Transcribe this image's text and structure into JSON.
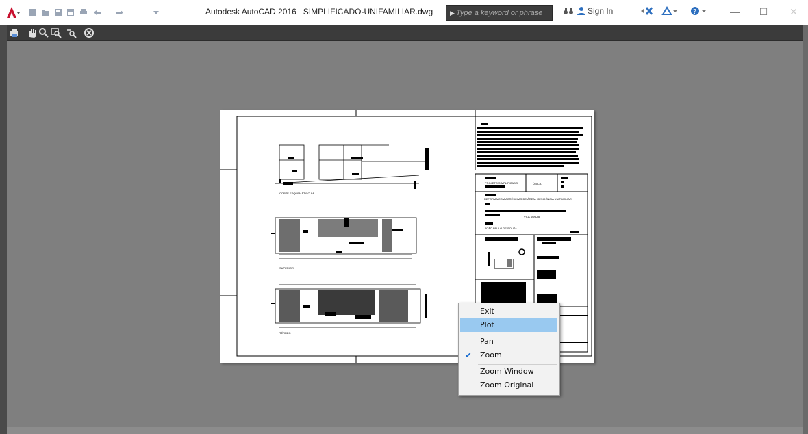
{
  "window": {
    "app_name": "Autodesk AutoCAD 2016",
    "file_name": "SIMPLIFICADO-UNIFAMILIAR.dwg",
    "controls": [
      "minimize-icon",
      "maximize-icon",
      "close-icon"
    ]
  },
  "search": {
    "placeholder": "Type a keyword or phrase"
  },
  "account": {
    "sign_in_label": "Sign In"
  },
  "quick_access_icons": [
    "new-icon",
    "open-icon",
    "save-icon",
    "save-as-icon",
    "plot-icon",
    "undo-icon",
    "redo-icon",
    "customize-icon"
  ],
  "preview_toolbar": {
    "tools": [
      "print-icon",
      "pan-icon",
      "zoom-icon",
      "zoom-window-icon",
      "zoom-original-icon",
      "close-preview-icon"
    ]
  },
  "sheet": {
    "views": [
      "CORTE ESQUEMÁTICO AA",
      "SUPERIOR",
      "TÉRREO"
    ],
    "title_block": {
      "project_label": "PROJETO SIMPLIFICADO",
      "unit_label": "ÚNICA",
      "description": "REFORMA COM ACRÉSCIMO DE ÁREA - RESIDÊNCIA UNIFAMILIAR",
      "owner": "JOÃO PAULO DE SOUZA",
      "address": "VILA SOUZA"
    }
  },
  "context_menu": {
    "items": [
      {
        "label": "Exit",
        "checked": false,
        "highlighted": false
      },
      {
        "label": "Plot",
        "checked": false,
        "highlighted": true
      },
      {
        "label": "Pan",
        "checked": false,
        "highlighted": false
      },
      {
        "label": "Zoom",
        "checked": true,
        "highlighted": false
      },
      {
        "label": "Zoom Window",
        "checked": false,
        "highlighted": false
      },
      {
        "label": "Zoom Original",
        "checked": false,
        "highlighted": false
      }
    ]
  },
  "colors": {
    "canvas_bg": "#7f7f7f",
    "toolbar_bg": "#3b3b3b",
    "menu_highlight": "#99c9f0",
    "autocad_red": "#c8102e"
  }
}
